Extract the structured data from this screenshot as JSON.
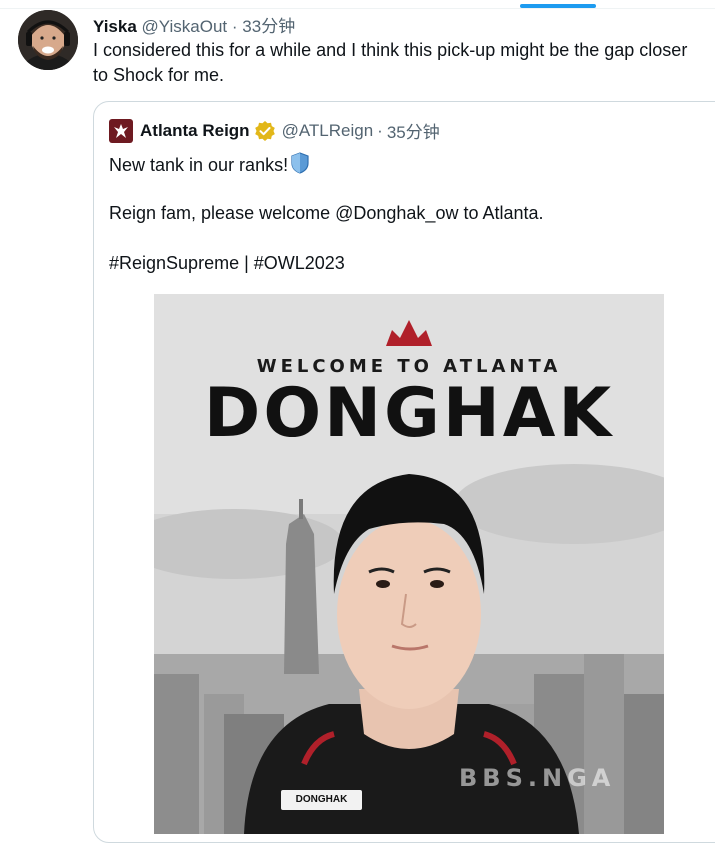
{
  "tweet": {
    "author_name": "Yiska",
    "author_handle": "@YiskaOut",
    "separator": "·",
    "timestamp": "33分钟",
    "text": "I considered this for a while and I think this pick-up might be the gap closer to Shock for me."
  },
  "quote": {
    "author_name": "Atlanta Reign",
    "author_handle": "@ATLReign",
    "separator": "·",
    "timestamp": "35分钟",
    "line1": "New tank in our ranks!",
    "line2": "Reign fam, please welcome @Donghak_ow to Atlanta.",
    "line3": "#ReignSupreme | #OWL2023",
    "emoji": "shield-emoji"
  },
  "media": {
    "welcome_text": "WELCOME TO ATLANTA",
    "player_name": "DONGHAK",
    "jersey_tag": "DONGHAK",
    "watermark": "BBS.NGA",
    "crown_color": "#b0202a"
  },
  "colors": {
    "accent": "#1d9bf0",
    "verified_gold": "#e2b719",
    "secondary_text": "#536471"
  }
}
